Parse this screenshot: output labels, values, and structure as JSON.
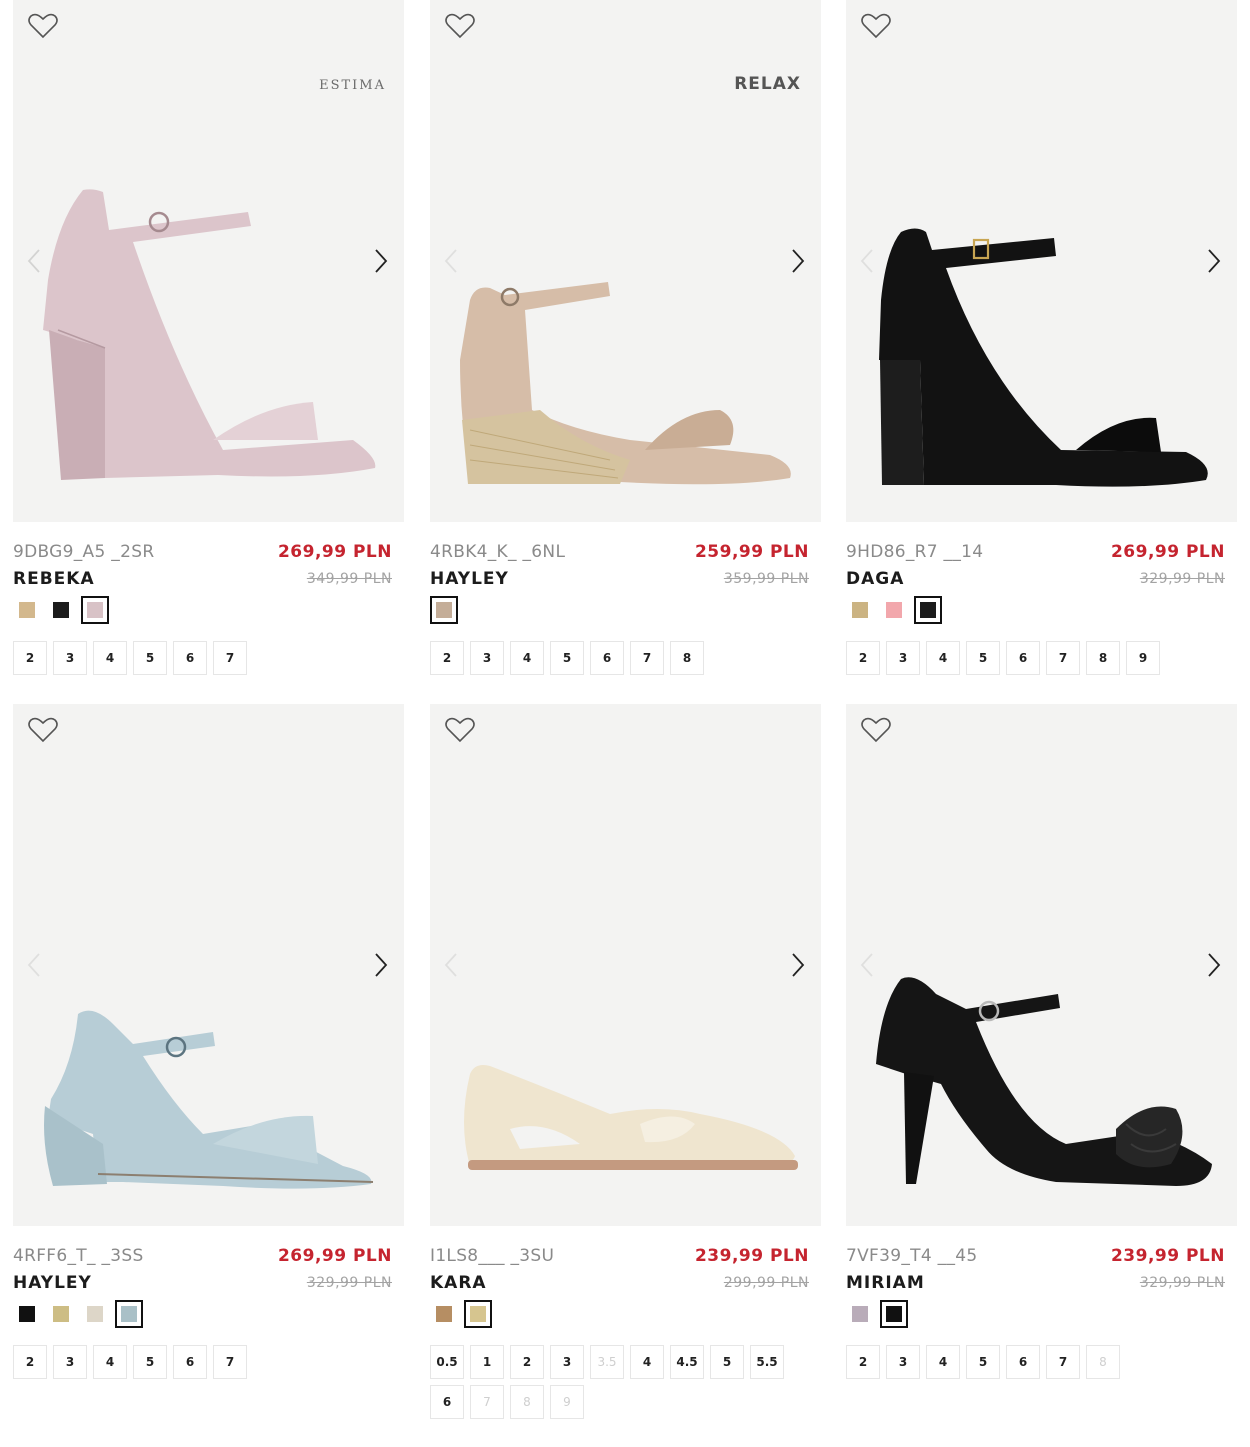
{
  "products": [
    {
      "code": "9DBG9_A5 _2SR",
      "name": "REBEKA",
      "price": "269,99 PLN",
      "old_price": "349,99 PLN",
      "brand": "ESTIMA",
      "shoe_color": "#dcc5cb",
      "swatches": [
        {
          "color": "#d3b88d",
          "selected": false
        },
        {
          "color": "#1b1b1b",
          "selected": false
        },
        {
          "color": "#d8c2c6",
          "selected": true
        }
      ],
      "sizes": [
        {
          "label": "2",
          "available": true
        },
        {
          "label": "3",
          "available": true
        },
        {
          "label": "4",
          "available": true
        },
        {
          "label": "5",
          "available": true
        },
        {
          "label": "6",
          "available": true
        },
        {
          "label": "7",
          "available": true
        }
      ]
    },
    {
      "code": "4RBK4_K_ _6NL",
      "name": "HAYLEY",
      "price": "259,99 PLN",
      "old_price": "359,99 PLN",
      "brand": "RELAX",
      "shoe_color": "#d6bda8",
      "swatches": [
        {
          "color": "#c4ad98",
          "selected": true
        }
      ],
      "sizes": [
        {
          "label": "2",
          "available": true
        },
        {
          "label": "3",
          "available": true
        },
        {
          "label": "4",
          "available": true
        },
        {
          "label": "5",
          "available": true
        },
        {
          "label": "6",
          "available": true
        },
        {
          "label": "7",
          "available": true
        },
        {
          "label": "8",
          "available": true
        }
      ]
    },
    {
      "code": "9HD86_R7 __14",
      "name": "DAGA",
      "price": "269,99 PLN",
      "old_price": "329,99 PLN",
      "brand": "",
      "shoe_color": "#121212",
      "swatches": [
        {
          "color": "#cbb382",
          "selected": false
        },
        {
          "color": "#f2a7ac",
          "selected": false
        },
        {
          "color": "#1b1b1b",
          "selected": true
        }
      ],
      "sizes": [
        {
          "label": "2",
          "available": true
        },
        {
          "label": "3",
          "available": true
        },
        {
          "label": "4",
          "available": true
        },
        {
          "label": "5",
          "available": true
        },
        {
          "label": "6",
          "available": true
        },
        {
          "label": "7",
          "available": true
        },
        {
          "label": "8",
          "available": true
        },
        {
          "label": "9",
          "available": true
        }
      ]
    },
    {
      "code": "4RFF6_T_ _3SS",
      "name": "HAYLEY",
      "price": "269,99 PLN",
      "old_price": "329,99 PLN",
      "brand": "",
      "shoe_color": "#b7cdd6",
      "swatches": [
        {
          "color": "#111111",
          "selected": false
        },
        {
          "color": "#cdbd84",
          "selected": false
        },
        {
          "color": "#ddd6c8",
          "selected": false
        },
        {
          "color": "#a9c0c7",
          "selected": true
        }
      ],
      "sizes": [
        {
          "label": "2",
          "available": true
        },
        {
          "label": "3",
          "available": true
        },
        {
          "label": "4",
          "available": true
        },
        {
          "label": "5",
          "available": true
        },
        {
          "label": "6",
          "available": true
        },
        {
          "label": "7",
          "available": true
        }
      ]
    },
    {
      "code": "I1LS8___ _3SU",
      "name": "KARA",
      "price": "239,99 PLN",
      "old_price": "299,99 PLN",
      "brand": "",
      "shoe_color": "#efe5cf",
      "swatches": [
        {
          "color": "#b68e63",
          "selected": false
        },
        {
          "color": "#d6c58f",
          "selected": true
        }
      ],
      "sizes": [
        {
          "label": "0.5",
          "available": true
        },
        {
          "label": "1",
          "available": true
        },
        {
          "label": "2",
          "available": true
        },
        {
          "label": "3",
          "available": true
        },
        {
          "label": "3.5",
          "available": false
        },
        {
          "label": "4",
          "available": true
        },
        {
          "label": "4.5",
          "available": true
        },
        {
          "label": "5",
          "available": true
        },
        {
          "label": "5.5",
          "available": true
        },
        {
          "label": "6",
          "available": true
        },
        {
          "label": "7",
          "available": false
        },
        {
          "label": "8",
          "available": false
        },
        {
          "label": "9",
          "available": false
        }
      ]
    },
    {
      "code": "7VF39_T4 __45",
      "name": "MIRIAM",
      "price": "239,99 PLN",
      "old_price": "329,99 PLN",
      "brand": "",
      "shoe_color": "#151515",
      "swatches": [
        {
          "color": "#b9acb9",
          "selected": false
        },
        {
          "color": "#111111",
          "selected": true
        }
      ],
      "sizes": [
        {
          "label": "2",
          "available": true
        },
        {
          "label": "3",
          "available": true
        },
        {
          "label": "4",
          "available": true
        },
        {
          "label": "5",
          "available": true
        },
        {
          "label": "6",
          "available": true
        },
        {
          "label": "7",
          "available": true
        },
        {
          "label": "8",
          "available": false
        }
      ]
    }
  ],
  "icons": {
    "wishlist": "heart-outline-icon",
    "prev": "chevron-left-icon",
    "next": "chevron-right-icon"
  },
  "colors": {
    "price": "#c5242f",
    "old_price": "#a3a3a3",
    "image_bg": "#f3f3f2"
  }
}
